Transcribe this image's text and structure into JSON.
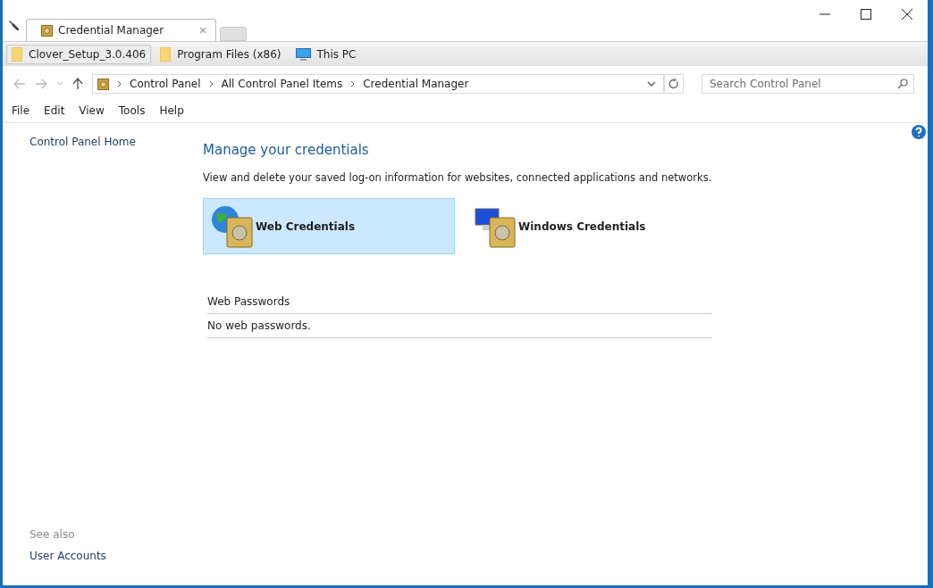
{
  "tabs": [
    {
      "label": "Credential Manager",
      "selected": true
    }
  ],
  "bookmarks": [
    {
      "label": "Clover_Setup_3.0.406",
      "kind": "folder",
      "selected": true
    },
    {
      "label": "Program Files (x86)",
      "kind": "folder",
      "selected": false
    },
    {
      "label": "This PC",
      "kind": "computer",
      "selected": false
    }
  ],
  "address": {
    "breadcrumbs": [
      "Control Panel",
      "All Control Panel Items",
      "Credential Manager"
    ]
  },
  "search": {
    "placeholder": "Search Control Panel"
  },
  "menu": [
    "File",
    "Edit",
    "View",
    "Tools",
    "Help"
  ],
  "sidebar": {
    "links": [
      "Control Panel Home"
    ],
    "see_also_heading": "See also",
    "see_also": [
      "User Accounts"
    ]
  },
  "main": {
    "title": "Manage your credentials",
    "description": "View and delete your saved log-on information for websites, connected applications and networks.",
    "credential_types": [
      {
        "label": "Web Credentials",
        "kind": "web",
        "selected": true
      },
      {
        "label": "Windows Credentials",
        "kind": "windows",
        "selected": false
      }
    ],
    "section": {
      "heading": "Web Passwords",
      "empty_text": "No web passwords."
    }
  }
}
